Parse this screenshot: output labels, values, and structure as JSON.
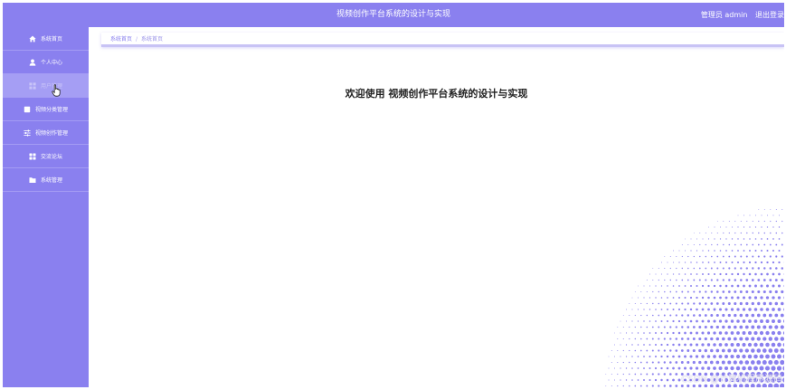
{
  "header": {
    "title": "视频创作平台系统的设计与实现",
    "user_label": "管理员 admin",
    "logout_label": "退出登录"
  },
  "sidebar": {
    "items": [
      {
        "label": "系统首页",
        "icon": "home-icon",
        "active": false
      },
      {
        "label": "个人中心",
        "icon": "user-icon",
        "active": false
      },
      {
        "label": "用户管理",
        "icon": "grid-icon",
        "active": true
      },
      {
        "label": "视频分类管理",
        "icon": "square-icon",
        "active": false
      },
      {
        "label": "视频创作管理",
        "icon": "sliders-icon",
        "active": false
      },
      {
        "label": "交流论坛",
        "icon": "apps-icon",
        "active": false
      },
      {
        "label": "系统管理",
        "icon": "folder-icon",
        "active": false
      }
    ]
  },
  "breadcrumb": {
    "home": "系统首页",
    "separator": "/",
    "current": "系统首页"
  },
  "main": {
    "welcome": "欢迎使用 视频创作平台系统的设计与实现"
  },
  "watermark": "CSDN @计算机程序源码",
  "colors": {
    "accent": "#8a80ef",
    "active_item": "#a59ef4",
    "halftone": "#8a80ef"
  }
}
